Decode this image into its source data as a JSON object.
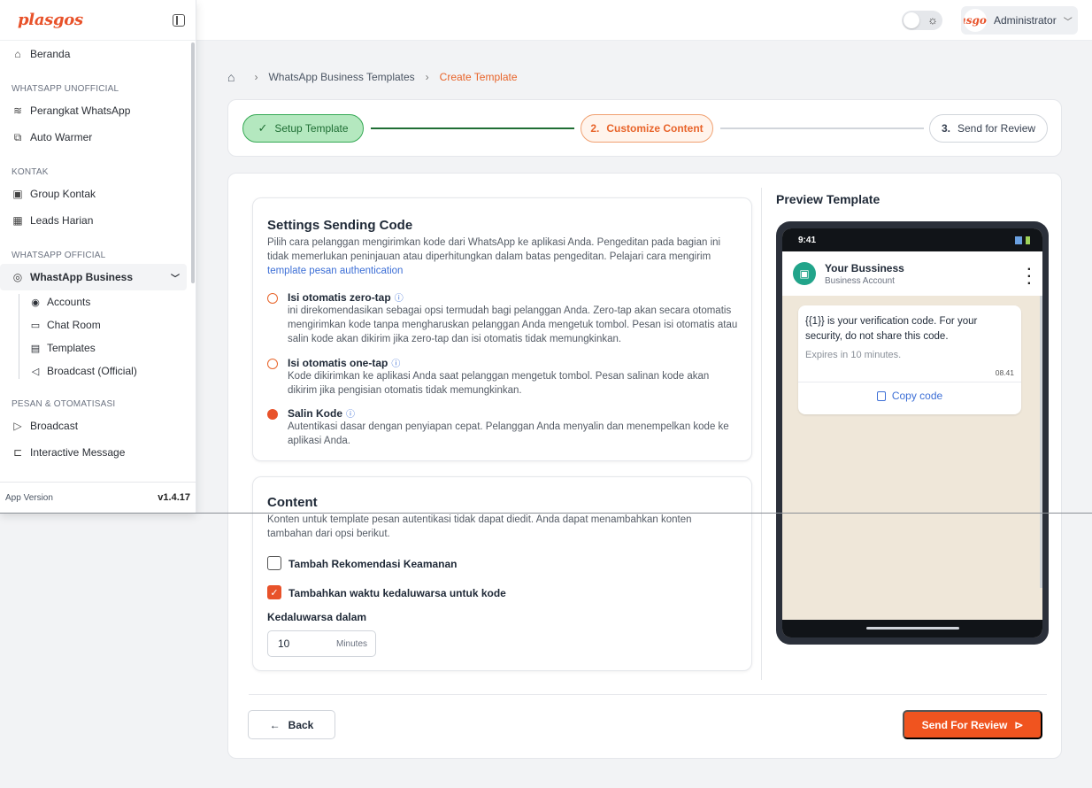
{
  "sidebar": {
    "logo": "plasgos",
    "items": [
      {
        "label": "Beranda",
        "icon": "home-icon",
        "glyph": "⌂"
      },
      {
        "section": "WHATSAPP UNOFFICIAL"
      },
      {
        "label": "Perangkat WhatsApp",
        "icon": "wifi-icon",
        "glyph": "≋"
      },
      {
        "label": "Auto Warmer",
        "icon": "warmer-icon",
        "glyph": "⧉"
      },
      {
        "section": "KONTAK"
      },
      {
        "label": "Group Kontak",
        "icon": "contacts-icon",
        "glyph": "▣"
      },
      {
        "label": "Leads Harian",
        "icon": "calendar-icon",
        "glyph": "▦"
      },
      {
        "section": "WHATSAPP OFFICIAL"
      },
      {
        "label": "WhastApp Business",
        "icon": "whatsapp-icon",
        "glyph": "◎",
        "active": true
      },
      {
        "label": "Accounts",
        "icon": "accounts-icon",
        "glyph": "◉",
        "sub": true
      },
      {
        "label": "Chat Room",
        "icon": "chat-icon",
        "glyph": "▭",
        "sub": true
      },
      {
        "label": "Templates",
        "icon": "templates-icon",
        "glyph": "▤",
        "sub": true
      },
      {
        "label": "Broadcast (Official)",
        "icon": "megaphone-icon",
        "glyph": "◁",
        "sub": true
      },
      {
        "section": "PESAN & OTOMATISASI"
      },
      {
        "label": "Broadcast",
        "icon": "send-icon",
        "glyph": "▷"
      },
      {
        "label": "Interactive Message",
        "icon": "flow-icon",
        "glyph": "⊏"
      }
    ],
    "app_version_label": "App Version",
    "app_version": "v1.4.17"
  },
  "topbar": {
    "user_name": "Administrator",
    "avatar_text": "asgo"
  },
  "breadcrumb": {
    "level1": "WhatsApp Business Templates",
    "current": "Create Template"
  },
  "stepper": {
    "step1": "Setup Template",
    "step2_num": "2.",
    "step2": "Customize Content",
    "step3_num": "3.",
    "step3": "Send for Review"
  },
  "settings": {
    "title": "Settings Sending Code",
    "desc": "Pilih cara pelanggan mengirimkan kode dari WhatsApp ke aplikasi Anda. Pengeditan pada bagian ini tidak memerlukan peninjauan atau diperhitungkan dalam batas pengeditan. Pelajari cara mengirim",
    "link": "template pesan authentication",
    "options": [
      {
        "title": "Isi otomatis zero-tap",
        "body": "ini direkomendasikan sebagai opsi termudah bagi pelanggan Anda. Zero-tap akan secara otomatis mengirimkan kode tanpa mengharuskan pelanggan Anda mengetuk tombol. Pesan isi otomatis atau salin kode akan dikirim jika zero-tap dan isi otomatis tidak memungkinkan.",
        "selected": false
      },
      {
        "title": "Isi otomatis one-tap",
        "body": "Kode dikirimkan ke aplikasi Anda saat pelanggan mengetuk tombol. Pesan salinan kode akan dikirim jika pengisian otomatis tidak memungkinkan.",
        "selected": false
      },
      {
        "title": "Salin Kode",
        "body": "Autentikasi dasar dengan penyiapan cepat. Pelanggan Anda menyalin dan menempelkan kode ke aplikasi Anda.",
        "selected": true
      }
    ]
  },
  "content": {
    "title": "Content",
    "desc": "Konten untuk template pesan autentikasi tidak dapat diedit. Anda dapat menambahkan konten tambahan dari opsi berikut.",
    "checkbox1": "Tambah Rekomendasi Keamanan",
    "checkbox1_checked": false,
    "checkbox2": "Tambahkan waktu kedaluwarsa untuk kode",
    "checkbox2_checked": true,
    "expiry_label": "Kedaluwarsa dalam",
    "expiry_value": "10",
    "expiry_unit": "Minutes"
  },
  "preview": {
    "title": "Preview Template",
    "status_time": "9:41",
    "business_name": "Your Bussiness",
    "business_sub": "Business Account",
    "message": "{{1}} is your verification code. For your security, do not share this code.",
    "expires": "Expires in 10 minutes.",
    "msg_time": "08.41",
    "copy_label": "Copy code"
  },
  "footer": {
    "back_label": "Back",
    "send_label": "Send For Review"
  },
  "colors": {
    "accent": "#e8522a",
    "success": "#34a853"
  }
}
